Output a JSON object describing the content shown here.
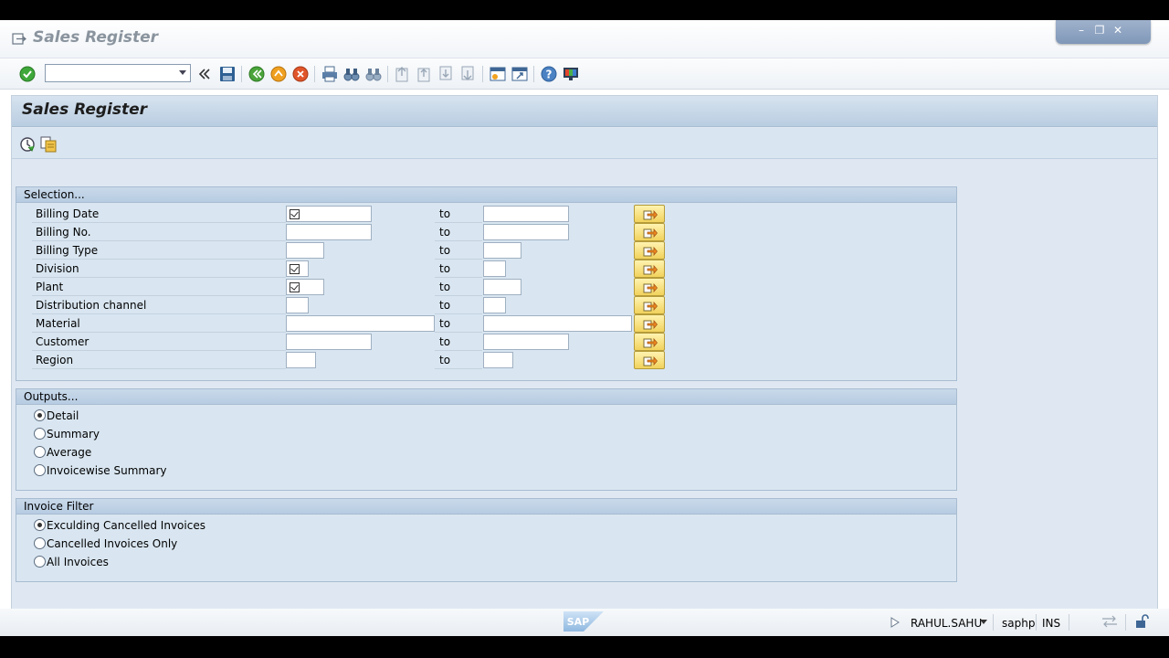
{
  "window": {
    "title": "Sales Register",
    "controls": [
      "minimize",
      "restore",
      "close"
    ]
  },
  "toolbar": {
    "command_field_value": "",
    "icons": [
      "enter-icon",
      "back-icon",
      "save-icon",
      "back-green-icon",
      "exit-icon",
      "cancel-icon",
      "print-icon",
      "find-icon",
      "find-next-icon",
      "first-page-icon",
      "prev-page-icon",
      "next-page-icon",
      "last-page-icon",
      "new-session-icon",
      "shortcut-icon",
      "help-icon",
      "customize-icon"
    ]
  },
  "main": {
    "title": "Sales Register",
    "app_toolbar_icons": [
      "execute-icon",
      "get-variant-icon"
    ]
  },
  "selection": {
    "title": "Selection...",
    "to_label": "to",
    "rows": [
      {
        "label": "Billing Date",
        "from": "",
        "to": "",
        "required": true
      },
      {
        "label": "Billing No.",
        "from": "",
        "to": "",
        "required": false
      },
      {
        "label": "Billing Type",
        "from": "",
        "to": "",
        "required": false
      },
      {
        "label": "Division",
        "from": "",
        "to": "",
        "required": true
      },
      {
        "label": "Plant",
        "from": "",
        "to": "",
        "required": true
      },
      {
        "label": "Distribution channel",
        "from": "",
        "to": "",
        "required": false
      },
      {
        "label": "Material",
        "from": "",
        "to": "",
        "required": false
      },
      {
        "label": "Customer",
        "from": "",
        "to": "",
        "required": false
      },
      {
        "label": "Region",
        "from": "",
        "to": "",
        "required": false
      }
    ]
  },
  "outputs": {
    "title": "Outputs...",
    "options": [
      {
        "label": "Detail",
        "selected": true
      },
      {
        "label": "Summary",
        "selected": false
      },
      {
        "label": "Average",
        "selected": false
      },
      {
        "label": "Invoicewise Summary",
        "selected": false
      }
    ]
  },
  "invoice_filter": {
    "title": "Invoice Filter",
    "options": [
      {
        "label": "Exculding Cancelled Invoices",
        "selected": true
      },
      {
        "label": "Cancelled Invoices Only",
        "selected": false
      },
      {
        "label": "All Invoices",
        "selected": false
      }
    ]
  },
  "status": {
    "logo": "SAP",
    "user": "RAHUL.SAHU",
    "server": "saphp",
    "mode": "INS"
  }
}
